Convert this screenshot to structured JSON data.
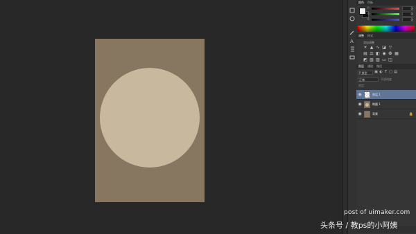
{
  "colors": {
    "workspace_bg": "#282828",
    "document_bg": "#877660",
    "circle_fill": "#c8b89e",
    "panel_bg": "#353535",
    "selected_layer": "#5f7596"
  },
  "color_panel": {
    "tabs": [
      "颜色",
      "色板"
    ],
    "sliders": [
      {
        "letter": "R",
        "value": "0"
      },
      {
        "letter": "G",
        "value": "0"
      },
      {
        "letter": "B",
        "value": "0"
      }
    ]
  },
  "adjustments_panel": {
    "tabs": [
      "调整",
      "样式"
    ],
    "title": "添加调整"
  },
  "layers_panel": {
    "tabs": [
      "图层",
      "通道",
      "路径"
    ],
    "kind_filter": "P 类型",
    "blend_mode": "正常",
    "opacity_label": "不透明度",
    "lock_label": "锁定:",
    "layers": [
      {
        "name": "图层 1",
        "thumb": "mask",
        "selected": true,
        "locked": false
      },
      {
        "name": "椭圆 1",
        "thumb": "circle",
        "selected": false,
        "locked": false
      },
      {
        "name": "背景",
        "thumb": "plain",
        "selected": false,
        "locked": true
      }
    ]
  },
  "watermark": {
    "site": "post of uimaker.com",
    "source": "头条号 / 教ps的小阿姨"
  }
}
